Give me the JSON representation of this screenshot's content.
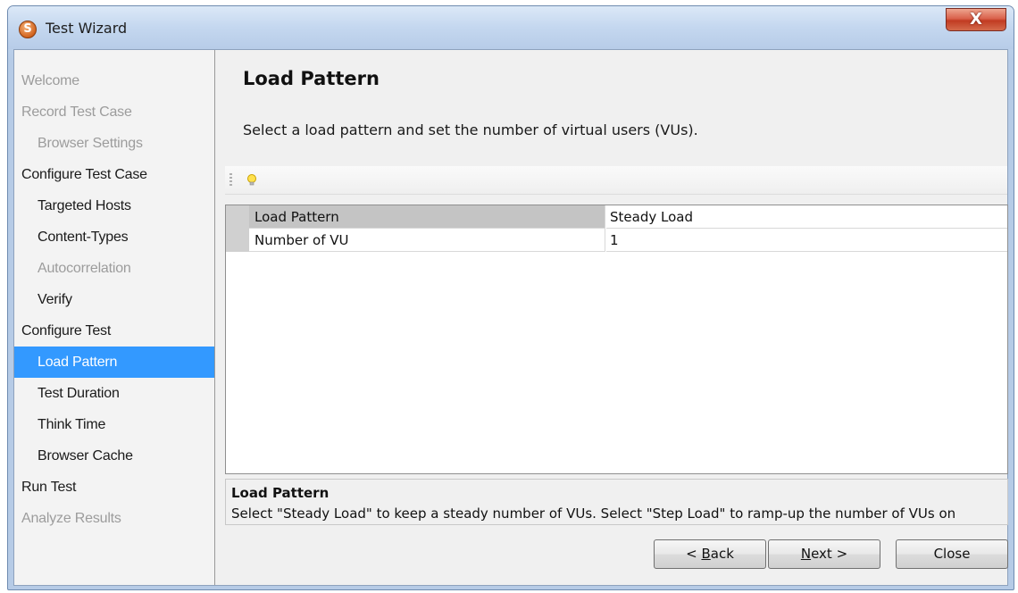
{
  "window": {
    "title": "Test Wizard",
    "icon": "S",
    "close_glyph": "X"
  },
  "sidebar": {
    "items": [
      {
        "label": "Welcome",
        "level": 0,
        "state": "disabled"
      },
      {
        "label": "Record Test Case",
        "level": 0,
        "state": "disabled"
      },
      {
        "label": "Browser Settings",
        "level": 1,
        "state": "disabled"
      },
      {
        "label": "Configure Test Case",
        "level": 0,
        "state": "normal"
      },
      {
        "label": "Targeted Hosts",
        "level": 1,
        "state": "normal"
      },
      {
        "label": "Content-Types",
        "level": 1,
        "state": "normal"
      },
      {
        "label": "Autocorrelation",
        "level": 1,
        "state": "disabled"
      },
      {
        "label": "Verify",
        "level": 1,
        "state": "normal"
      },
      {
        "label": "Configure Test",
        "level": 0,
        "state": "normal"
      },
      {
        "label": "Load Pattern",
        "level": 1,
        "state": "active"
      },
      {
        "label": "Test Duration",
        "level": 1,
        "state": "normal"
      },
      {
        "label": "Think Time",
        "level": 1,
        "state": "normal"
      },
      {
        "label": "Browser Cache",
        "level": 1,
        "state": "normal"
      },
      {
        "label": "Run Test",
        "level": 0,
        "state": "normal"
      },
      {
        "label": "Analyze Results",
        "level": 0,
        "state": "disabled"
      }
    ]
  },
  "main": {
    "title": "Load Pattern",
    "description": "Select a load pattern and set the number of virtual users (VUs).",
    "properties": [
      {
        "name": "Load Pattern",
        "value": "Steady Load"
      },
      {
        "name": "Number of VU",
        "value": "1"
      }
    ],
    "help": {
      "title": "Load Pattern",
      "text": "Select \"Steady Load\" to keep a steady number of VUs. Select \"Step Load\" to ramp-up the number of VUs on"
    }
  },
  "buttons": {
    "back": {
      "prefix": "< ",
      "mnemonic": "B",
      "rest": "ack"
    },
    "next": {
      "mnemonic": "N",
      "rest": "ext >"
    },
    "close": "Close"
  },
  "colors": {
    "accent": "#3399ff",
    "selected_row": "#c4c4c4"
  }
}
